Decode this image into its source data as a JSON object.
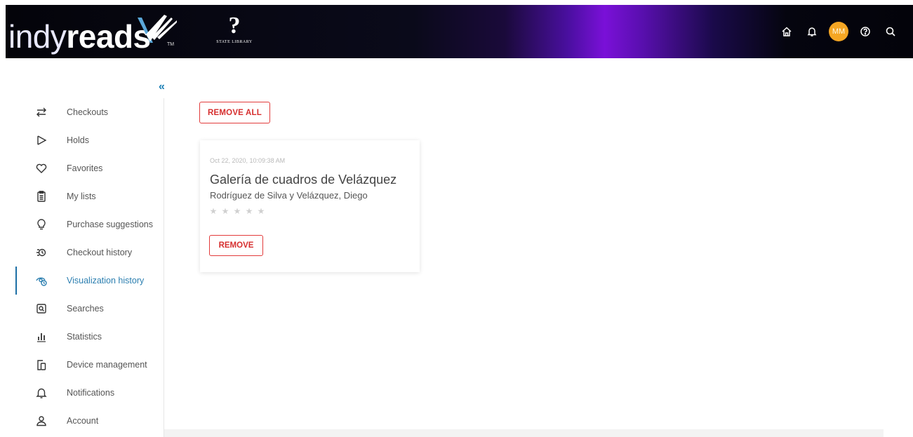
{
  "header": {
    "logo_light": "indy",
    "logo_bold": "reads",
    "logo_tm": "TM",
    "state_library_mark": "?",
    "state_library_text": "STATE LIBRARY",
    "avatar_initials": "MM",
    "icons": [
      "home-icon",
      "bell-icon",
      "avatar",
      "help-icon",
      "search-icon"
    ],
    "accent_color": "#7a10d8"
  },
  "sidebar": {
    "collapse_glyph": "«",
    "items": [
      {
        "label": "Checkouts",
        "icon": "swap-arrows-icon"
      },
      {
        "label": "Holds",
        "icon": "flag-icon"
      },
      {
        "label": "Favorites",
        "icon": "heart-icon"
      },
      {
        "label": "My lists",
        "icon": "clipboard-icon"
      },
      {
        "label": "Purchase suggestions",
        "icon": "lightbulb-icon"
      },
      {
        "label": "Checkout history",
        "icon": "history-icon"
      },
      {
        "label": "Visualization history",
        "icon": "eye-history-icon",
        "active": true
      },
      {
        "label": "Searches",
        "icon": "search-box-icon"
      },
      {
        "label": "Statistics",
        "icon": "bar-chart-icon"
      },
      {
        "label": "Device management",
        "icon": "devices-icon"
      },
      {
        "label": "Notifications",
        "icon": "bell-icon"
      },
      {
        "label": "Account",
        "icon": "user-icon"
      }
    ],
    "active_color": "#2c7fb0"
  },
  "main": {
    "remove_all_label": "REMOVE ALL",
    "card": {
      "date": "Oct 22, 2020, 10:09:38 AM",
      "title": "Galería de cuadros de Velázquez",
      "author": "Rodríguez de Silva y Velázquez, Diego",
      "rating": 0,
      "max_rating": 5,
      "remove_label": "REMOVE"
    },
    "button_color": "#d62f2f"
  }
}
